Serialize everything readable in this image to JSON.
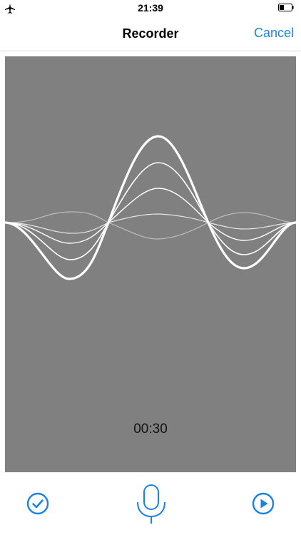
{
  "status_bar": {
    "time": "21:39",
    "icons": [
      "airplane-icon",
      "battery-icon"
    ]
  },
  "nav": {
    "title": "Recorder",
    "cancel_label": "Cancel"
  },
  "recorder": {
    "elapsed": "00:30"
  },
  "toolbar": {
    "icons": [
      "checkmark-icon",
      "microphone-icon",
      "play-icon"
    ]
  },
  "colors": {
    "accent": "#1a82e6",
    "wave_background": "#808080",
    "wave": "#ffffff"
  }
}
